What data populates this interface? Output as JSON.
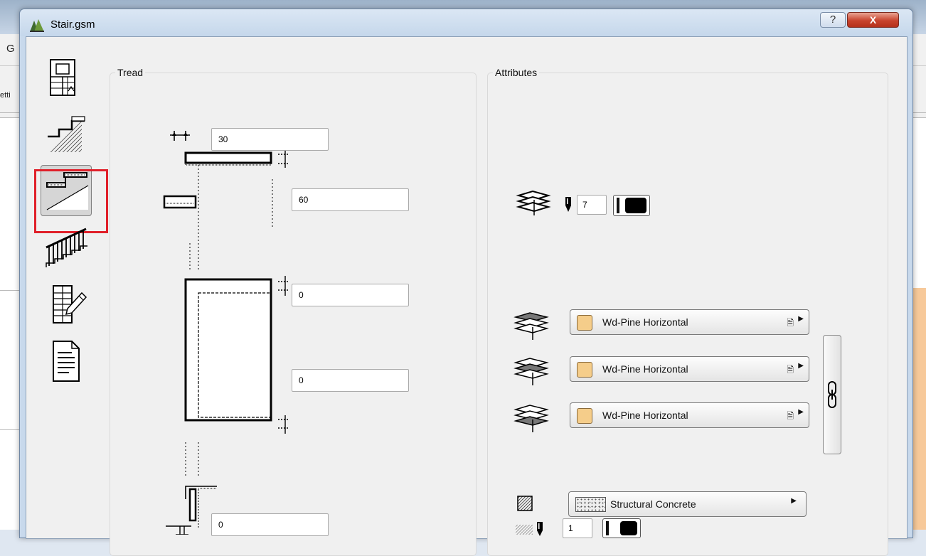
{
  "window": {
    "title": "Stair.gsm",
    "help_label": "?",
    "close_label": "X"
  },
  "background": {
    "menu_letter": "G",
    "toolbar_text": "etti"
  },
  "sidebar": {
    "items": [
      {
        "name": "plan-view",
        "icon": "stair-plan-icon",
        "selected": false
      },
      {
        "name": "stair-structure",
        "icon": "stair-structure-icon",
        "selected": false
      },
      {
        "name": "tread",
        "icon": "stair-tread-icon",
        "selected": true
      },
      {
        "name": "railing",
        "icon": "railing-icon",
        "selected": false
      },
      {
        "name": "plan-symbol",
        "icon": "plan-edit-icon",
        "selected": false
      },
      {
        "name": "listing",
        "icon": "document-icon",
        "selected": false
      }
    ],
    "selection_color": "#e0202a"
  },
  "tread": {
    "title": "Tread",
    "thickness": "30",
    "nosing": "60",
    "front_offset": "0",
    "back_offset": "0",
    "riser_offset": "0"
  },
  "attributes": {
    "title": "Attributes",
    "pen_value": "7",
    "materials": [
      {
        "label": "Wd-Pine Horizontal",
        "swatch_color": "#f5cd8a"
      },
      {
        "label": "Wd-Pine Horizontal",
        "swatch_color": "#f5cd8a"
      },
      {
        "label": "Wd-Pine Horizontal",
        "swatch_color": "#f5cd8a"
      }
    ],
    "fill": {
      "label": "Structural Concrete",
      "pen_value": "1"
    }
  }
}
